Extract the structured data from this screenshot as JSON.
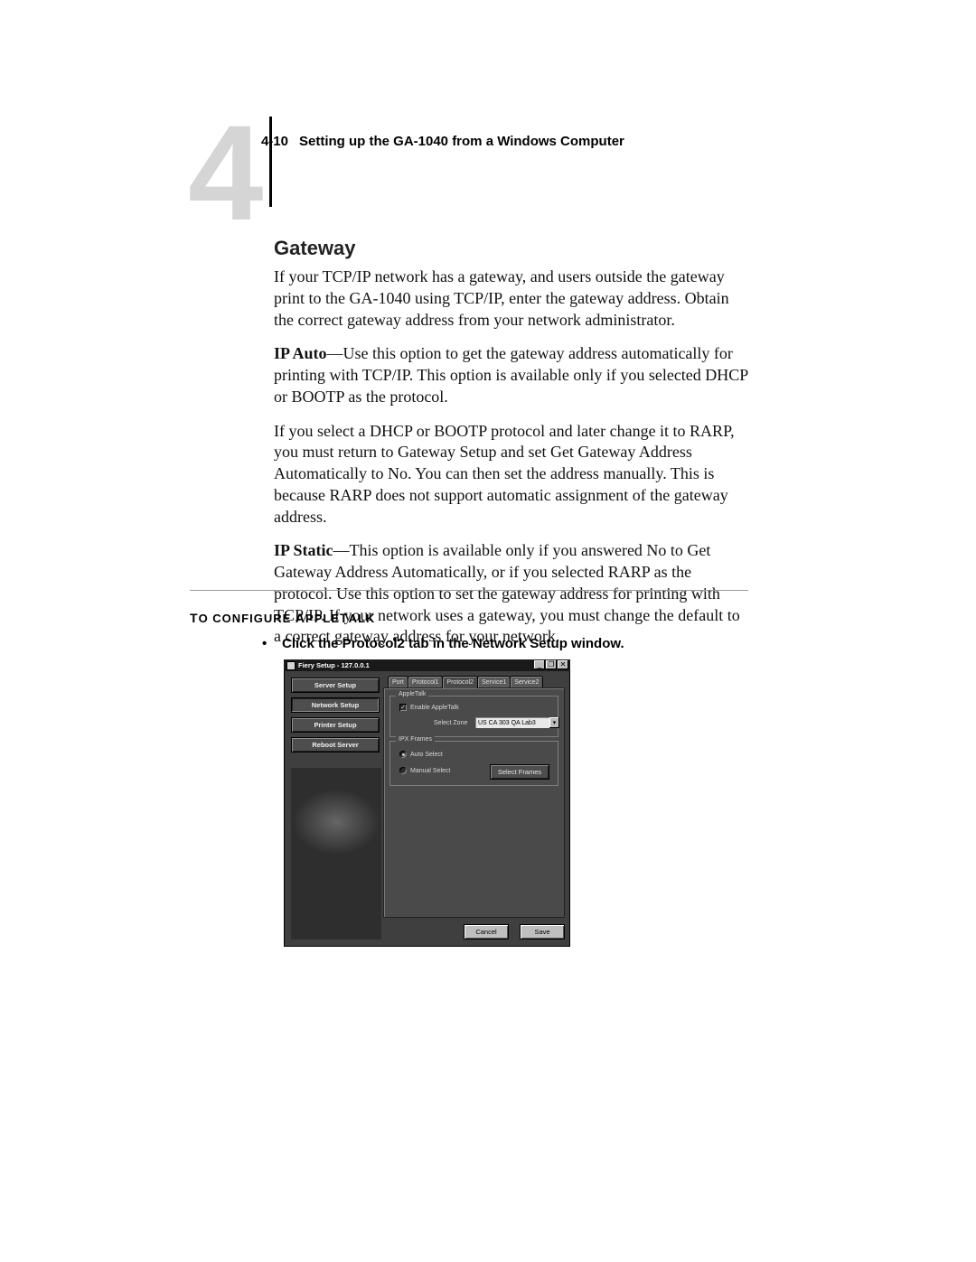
{
  "header": {
    "chapter_digit": "4",
    "page_ref": "4-10",
    "title": "Setting up the GA-1040 from a Windows Computer"
  },
  "section": {
    "heading": "Gateway",
    "para1": "If your TCP/IP network has a gateway, and users outside the gateway print to the GA-1040 using TCP/IP, enter the gateway address. Obtain the correct gateway address from your network administrator.",
    "para2a": "IP Auto",
    "para2b": "—Use this option to get the gateway address automatically for printing with TCP/IP. This option is available only if you selected DHCP or BOOTP as the protocol.",
    "para3": "If you select a DHCP or BOOTP protocol and later change it to RARP, you must return to Gateway Setup and set Get Gateway Address Automatically to No. You can then set the address manually. This is because RARP does not support automatic assignment of the gateway address.",
    "para4a": "IP Static",
    "para4b": "—This option is available only if you answered No to Get Gateway Address Automatically, or if you selected RARP as the protocol. Use this option to set the gateway address for printing with TCP/IP. If your network uses a gateway, you must change the default to a correct gateway address for your network."
  },
  "procedure": {
    "title_pre": "T",
    "title_rest_1": "O CONFIGURE ",
    "title_mid": "A",
    "title_rest_2": "PPLE",
    "title_mid2": "T",
    "title_rest_3": "ALK",
    "step_bullet": "•",
    "step_text": "Click the Protocol2 tab in the Network Setup window."
  },
  "dialog": {
    "title": "Fiery Setup - 127.0.0.1",
    "win_min": "_",
    "win_max": "❐",
    "win_close": "✕",
    "tabs": [
      "Port",
      "Protocol1",
      "Protocol2",
      "Service1",
      "Service2"
    ],
    "active_tab_index": 2,
    "side_buttons": [
      "Server Setup",
      "Network Setup",
      "Printer Setup",
      "Reboot Server"
    ],
    "active_side_index": 1,
    "group1": {
      "legend": "AppleTalk",
      "enable_label": "Enable AppleTalk",
      "enable_checked": true,
      "zone_label": "Select Zone",
      "zone_value": "US CA 303 QA Lab3"
    },
    "group2": {
      "legend": "IPX Frames",
      "radio_auto": "Auto Select",
      "radio_manual": "Manual Select",
      "selected_index": 0,
      "select_frames_btn": "Select Frames"
    },
    "buttons": {
      "cancel": "Cancel",
      "save": "Save"
    }
  }
}
